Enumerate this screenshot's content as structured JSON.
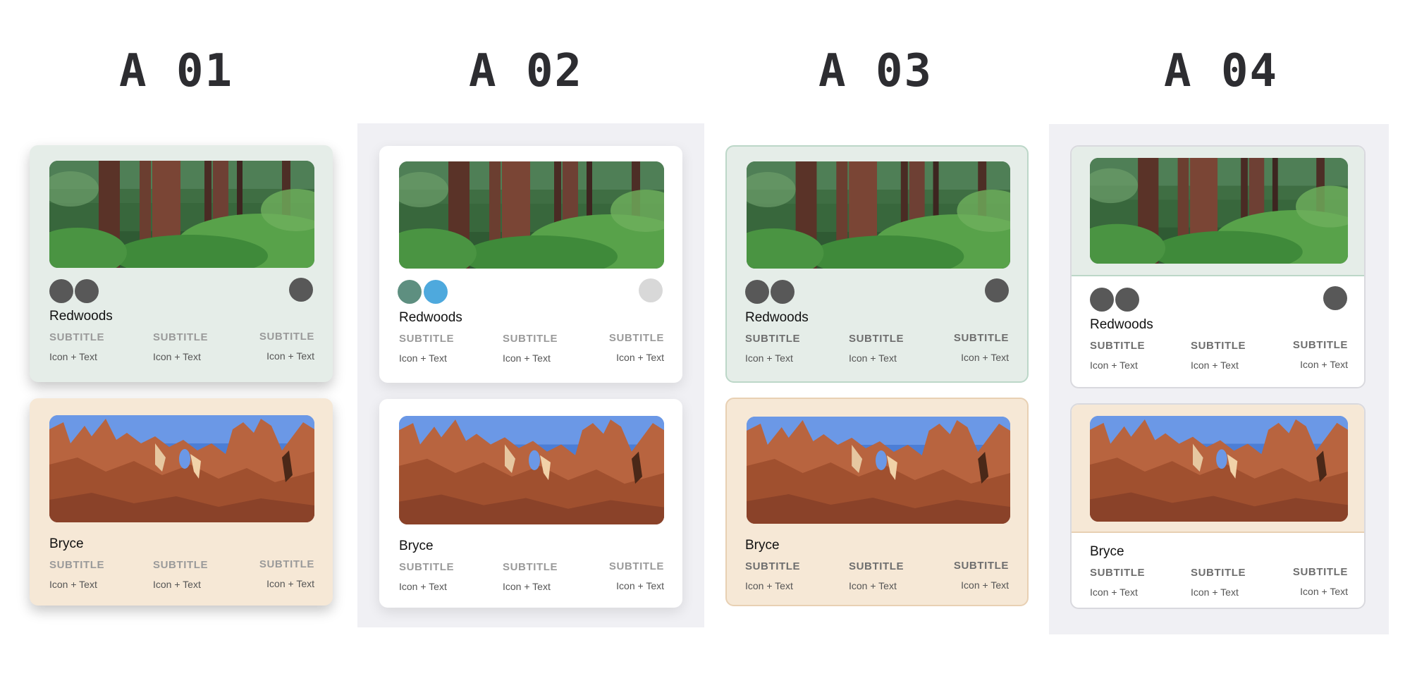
{
  "columns": [
    {
      "label": "A 01"
    },
    {
      "label": "A 02"
    },
    {
      "label": "A 03"
    },
    {
      "label": "A 04"
    }
  ],
  "cards": {
    "redwoods": {
      "title": "Redwoods",
      "photo_icon": "forest-photo",
      "meta": [
        {
          "subtitle": "SUBTITLE",
          "text": "Icon + Text"
        },
        {
          "subtitle": "SUBTITLE",
          "text": "Icon + Text"
        },
        {
          "subtitle": "SUBTITLE",
          "text": "Icon + Text"
        }
      ]
    },
    "bryce": {
      "title": "Bryce",
      "photo_icon": "canyon-photo",
      "meta": [
        {
          "subtitle": "SUBTITLE",
          "text": "Icon + Text"
        },
        {
          "subtitle": "SUBTITLE",
          "text": "Icon + Text"
        },
        {
          "subtitle": "SUBTITLE",
          "text": "Icon + Text"
        }
      ]
    }
  },
  "colors": {
    "green_tint": "#e5ede8",
    "tan_tint": "#f6e8d6",
    "dot_gray": "#585858",
    "dot_teal": "#5e8f80",
    "dot_blue": "#4ea9dd",
    "dot_light": "#d8d8d8",
    "panel_bg": "#f0f0f4"
  }
}
